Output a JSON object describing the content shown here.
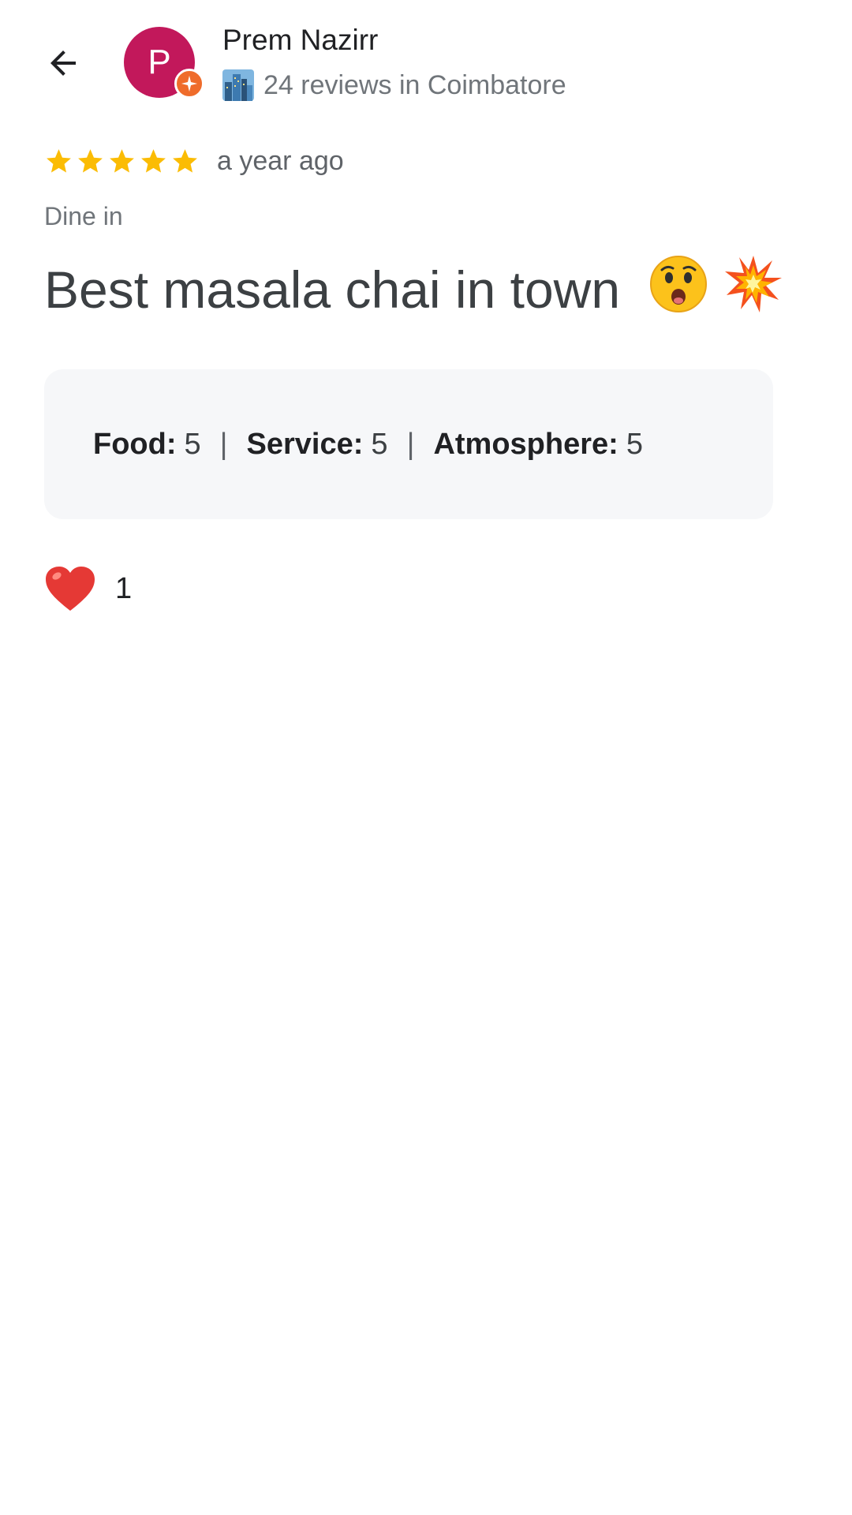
{
  "header": {
    "back_icon": "arrow-left-icon",
    "avatar_letter": "P",
    "avatar_color": "#c2185b",
    "badge_icon": "local-guide-star-icon",
    "badge_color": "#ef6c2b",
    "reviewer_name": "Prem Nazirr",
    "city_icon": "cityscape-icon",
    "reviewer_meta": "24 reviews in Coimbatore"
  },
  "review": {
    "stars": 5,
    "star_color": "#fbbc04",
    "time_ago": "a year ago",
    "dine_mode": "Dine in",
    "text": "Best masala chai in town",
    "emojis": [
      "astonished-face-icon",
      "collision-icon"
    ]
  },
  "ratings": [
    {
      "label": "Food:",
      "value": "5"
    },
    {
      "label": "Service:",
      "value": "5"
    },
    {
      "label": "Atmosphere:",
      "value": "5"
    }
  ],
  "reactions": {
    "icon": "heart-icon",
    "count": "1"
  }
}
